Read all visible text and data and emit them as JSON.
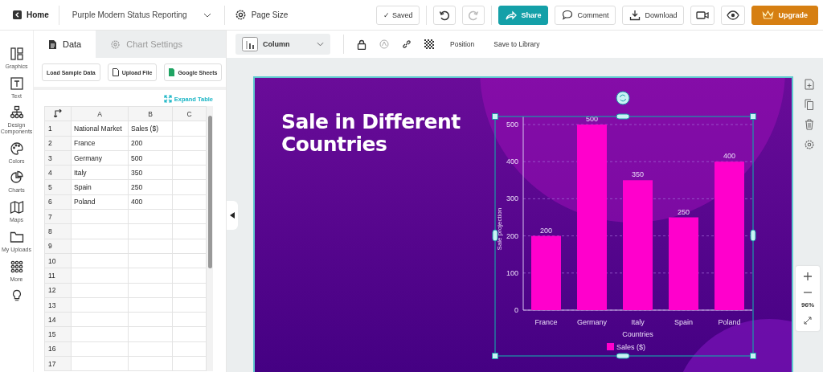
{
  "top_bar": {
    "home": "Home",
    "document_title": "Purple Modern Status Reporting",
    "page_size": "Page Size",
    "saved": "✓ Saved",
    "share": "Share",
    "comment": "Comment",
    "download": "Download",
    "upgrade": "Upgrade"
  },
  "sidebar": {
    "items": [
      {
        "label": "Graphics"
      },
      {
        "label": "Text"
      },
      {
        "label": "Design Components"
      },
      {
        "label": "Colors"
      },
      {
        "label": "Charts"
      },
      {
        "label": "Maps"
      },
      {
        "label": "My Uploads"
      },
      {
        "label": "More"
      }
    ]
  },
  "data_panel": {
    "tabs": [
      {
        "label": "Data",
        "selected": true
      },
      {
        "label": "Chart Settings",
        "selected": false
      }
    ],
    "buttons": [
      "Load Sample Data",
      "Upload File",
      "Google Sheets"
    ],
    "expand_table": "Expand Table",
    "table": {
      "columns": [
        "A",
        "B",
        "C"
      ],
      "rows": [
        {
          "number": "1",
          "cells": [
            "National Market",
            "Sales ($)"
          ]
        },
        {
          "number": "2",
          "cells": [
            "France",
            "200"
          ]
        },
        {
          "number": "3",
          "cells": [
            "Germany",
            "500"
          ]
        },
        {
          "number": "4",
          "cells": [
            "Italy",
            "350"
          ]
        },
        {
          "number": "5",
          "cells": [
            "Spain",
            "250"
          ]
        },
        {
          "number": "6",
          "cells": [
            "Poland",
            "400"
          ]
        },
        {
          "number": "7",
          "cells": []
        },
        {
          "number": "8",
          "cells": []
        },
        {
          "number": "9",
          "cells": []
        },
        {
          "number": "10",
          "cells": []
        },
        {
          "number": "11",
          "cells": []
        },
        {
          "number": "12",
          "cells": []
        },
        {
          "number": "13",
          "cells": []
        },
        {
          "number": "14",
          "cells": []
        },
        {
          "number": "15",
          "cells": []
        },
        {
          "number": "16",
          "cells": []
        },
        {
          "number": "17",
          "cells": []
        }
      ]
    }
  },
  "toolbar": {
    "chart_type": "Column",
    "position": "Position",
    "save_to_library": "Save to Library"
  },
  "canvas": {
    "title": "Sale in Different Countries",
    "chart_data": {
      "type": "bar",
      "xlabel": "Countries",
      "ylabel": "Sale projection",
      "categories": [
        "France",
        "Germany",
        "Italy",
        "Spain",
        "Poland"
      ],
      "series": [
        {
          "name": "Sales ($)",
          "color": "#ff00cc",
          "values": [
            200,
            500,
            350,
            250,
            400
          ]
        }
      ],
      "ylim": [
        0,
        500
      ],
      "grid": true,
      "yticks": [
        0,
        100,
        200,
        300,
        400,
        500
      ],
      "data_labels": true
    }
  },
  "zoom": {
    "level_text": "96%"
  }
}
